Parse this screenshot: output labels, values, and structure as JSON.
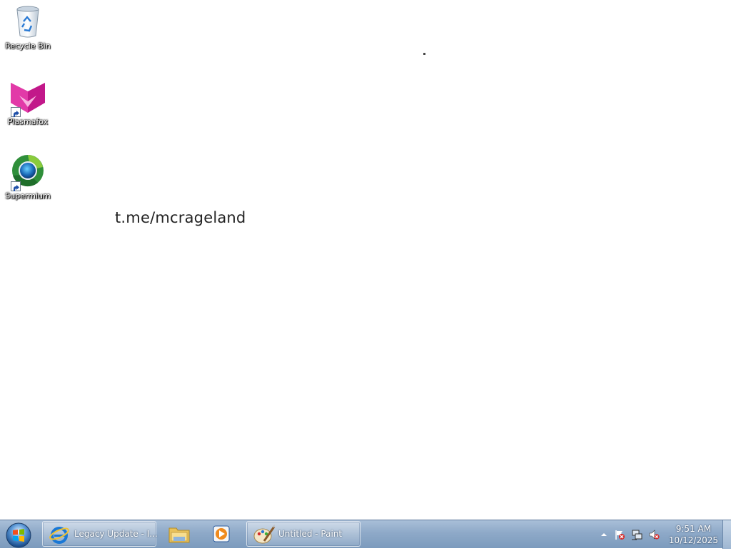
{
  "desktop": {
    "icons": [
      {
        "label": "Recycle Bin"
      },
      {
        "label": "Plasmafox"
      },
      {
        "label": "Supermium"
      }
    ],
    "paint_text": "t.me/mcrageland"
  },
  "taskbar": {
    "start_label": "Start",
    "buttons": [
      {
        "label": "Legacy Update - I..."
      },
      {
        "label": ""
      },
      {
        "label": ""
      },
      {
        "label": "Untitled - Paint"
      }
    ],
    "clock": {
      "time": "9:51 AM",
      "date": "10/12/2025"
    }
  },
  "colors": {
    "taskbar_top": "#a9bfd8",
    "taskbar_bottom": "#7c9bbd",
    "desktop_bg": "#ffffff"
  }
}
